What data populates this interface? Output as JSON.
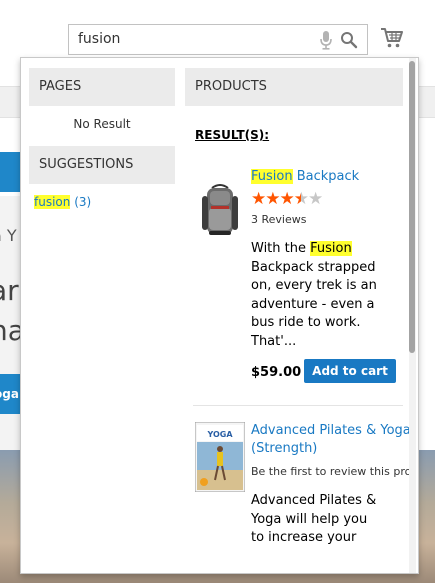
{
  "search": {
    "value": "fusion"
  },
  "background_snippets": {
    "line1": "a Y",
    "line2": "ar",
    "line3": "na",
    "button": "oga"
  },
  "autocomplete": {
    "pages": {
      "heading": "PAGES",
      "empty_text": "No Result"
    },
    "suggestions": {
      "heading": "SUGGESTIONS",
      "items": [
        {
          "term": "fusion",
          "count": "(3)"
        }
      ]
    },
    "products": {
      "heading": "PRODUCTS",
      "results_label": "RESULT(S):",
      "items": [
        {
          "name_highlight": "Fusion",
          "name_rest": " Backpack",
          "rating_stars": 3.5,
          "rating_max": 5,
          "reviews": "3 Reviews",
          "desc_before": "With the ",
          "desc_highlight": "Fusion",
          "desc_after": " Backpack strapped on, every trek is an adventure - even a bus ride to work. That'...",
          "price": "$59.00",
          "add_to_cart": "Add to cart"
        },
        {
          "name": "Advanced Pilates & Yoga (Strength)",
          "review_prompt": "Be the first to review this pro",
          "desc": "Advanced Pilates & Yoga will help you to increase your",
          "dvd_cover_text": "YOGA"
        }
      ]
    }
  },
  "colors": {
    "link": "#1979c3",
    "highlight": "#ffff2e",
    "star": "#ff5501",
    "button": "#1979c3"
  }
}
